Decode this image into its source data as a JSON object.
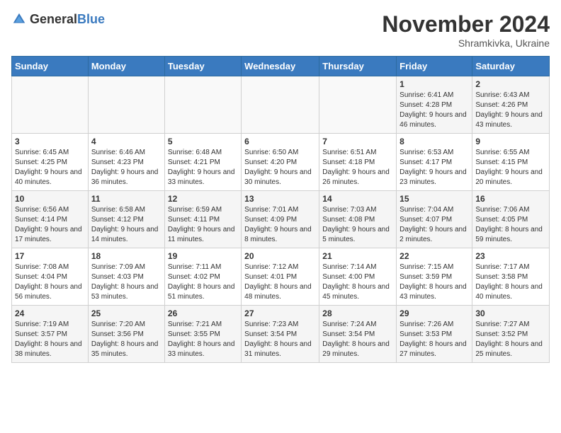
{
  "logo": {
    "text_general": "General",
    "text_blue": "Blue"
  },
  "title": "November 2024",
  "subtitle": "Shramkivka, Ukraine",
  "days_of_week": [
    "Sunday",
    "Monday",
    "Tuesday",
    "Wednesday",
    "Thursday",
    "Friday",
    "Saturday"
  ],
  "weeks": [
    [
      {
        "day": "",
        "info": ""
      },
      {
        "day": "",
        "info": ""
      },
      {
        "day": "",
        "info": ""
      },
      {
        "day": "",
        "info": ""
      },
      {
        "day": "",
        "info": ""
      },
      {
        "day": "1",
        "info": "Sunrise: 6:41 AM\nSunset: 4:28 PM\nDaylight: 9 hours and 46 minutes."
      },
      {
        "day": "2",
        "info": "Sunrise: 6:43 AM\nSunset: 4:26 PM\nDaylight: 9 hours and 43 minutes."
      }
    ],
    [
      {
        "day": "3",
        "info": "Sunrise: 6:45 AM\nSunset: 4:25 PM\nDaylight: 9 hours and 40 minutes."
      },
      {
        "day": "4",
        "info": "Sunrise: 6:46 AM\nSunset: 4:23 PM\nDaylight: 9 hours and 36 minutes."
      },
      {
        "day": "5",
        "info": "Sunrise: 6:48 AM\nSunset: 4:21 PM\nDaylight: 9 hours and 33 minutes."
      },
      {
        "day": "6",
        "info": "Sunrise: 6:50 AM\nSunset: 4:20 PM\nDaylight: 9 hours and 30 minutes."
      },
      {
        "day": "7",
        "info": "Sunrise: 6:51 AM\nSunset: 4:18 PM\nDaylight: 9 hours and 26 minutes."
      },
      {
        "day": "8",
        "info": "Sunrise: 6:53 AM\nSunset: 4:17 PM\nDaylight: 9 hours and 23 minutes."
      },
      {
        "day": "9",
        "info": "Sunrise: 6:55 AM\nSunset: 4:15 PM\nDaylight: 9 hours and 20 minutes."
      }
    ],
    [
      {
        "day": "10",
        "info": "Sunrise: 6:56 AM\nSunset: 4:14 PM\nDaylight: 9 hours and 17 minutes."
      },
      {
        "day": "11",
        "info": "Sunrise: 6:58 AM\nSunset: 4:12 PM\nDaylight: 9 hours and 14 minutes."
      },
      {
        "day": "12",
        "info": "Sunrise: 6:59 AM\nSunset: 4:11 PM\nDaylight: 9 hours and 11 minutes."
      },
      {
        "day": "13",
        "info": "Sunrise: 7:01 AM\nSunset: 4:09 PM\nDaylight: 9 hours and 8 minutes."
      },
      {
        "day": "14",
        "info": "Sunrise: 7:03 AM\nSunset: 4:08 PM\nDaylight: 9 hours and 5 minutes."
      },
      {
        "day": "15",
        "info": "Sunrise: 7:04 AM\nSunset: 4:07 PM\nDaylight: 9 hours and 2 minutes."
      },
      {
        "day": "16",
        "info": "Sunrise: 7:06 AM\nSunset: 4:05 PM\nDaylight: 8 hours and 59 minutes."
      }
    ],
    [
      {
        "day": "17",
        "info": "Sunrise: 7:08 AM\nSunset: 4:04 PM\nDaylight: 8 hours and 56 minutes."
      },
      {
        "day": "18",
        "info": "Sunrise: 7:09 AM\nSunset: 4:03 PM\nDaylight: 8 hours and 53 minutes."
      },
      {
        "day": "19",
        "info": "Sunrise: 7:11 AM\nSunset: 4:02 PM\nDaylight: 8 hours and 51 minutes."
      },
      {
        "day": "20",
        "info": "Sunrise: 7:12 AM\nSunset: 4:01 PM\nDaylight: 8 hours and 48 minutes."
      },
      {
        "day": "21",
        "info": "Sunrise: 7:14 AM\nSunset: 4:00 PM\nDaylight: 8 hours and 45 minutes."
      },
      {
        "day": "22",
        "info": "Sunrise: 7:15 AM\nSunset: 3:59 PM\nDaylight: 8 hours and 43 minutes."
      },
      {
        "day": "23",
        "info": "Sunrise: 7:17 AM\nSunset: 3:58 PM\nDaylight: 8 hours and 40 minutes."
      }
    ],
    [
      {
        "day": "24",
        "info": "Sunrise: 7:19 AM\nSunset: 3:57 PM\nDaylight: 8 hours and 38 minutes."
      },
      {
        "day": "25",
        "info": "Sunrise: 7:20 AM\nSunset: 3:56 PM\nDaylight: 8 hours and 35 minutes."
      },
      {
        "day": "26",
        "info": "Sunrise: 7:21 AM\nSunset: 3:55 PM\nDaylight: 8 hours and 33 minutes."
      },
      {
        "day": "27",
        "info": "Sunrise: 7:23 AM\nSunset: 3:54 PM\nDaylight: 8 hours and 31 minutes."
      },
      {
        "day": "28",
        "info": "Sunrise: 7:24 AM\nSunset: 3:54 PM\nDaylight: 8 hours and 29 minutes."
      },
      {
        "day": "29",
        "info": "Sunrise: 7:26 AM\nSunset: 3:53 PM\nDaylight: 8 hours and 27 minutes."
      },
      {
        "day": "30",
        "info": "Sunrise: 7:27 AM\nSunset: 3:52 PM\nDaylight: 8 hours and 25 minutes."
      }
    ]
  ]
}
